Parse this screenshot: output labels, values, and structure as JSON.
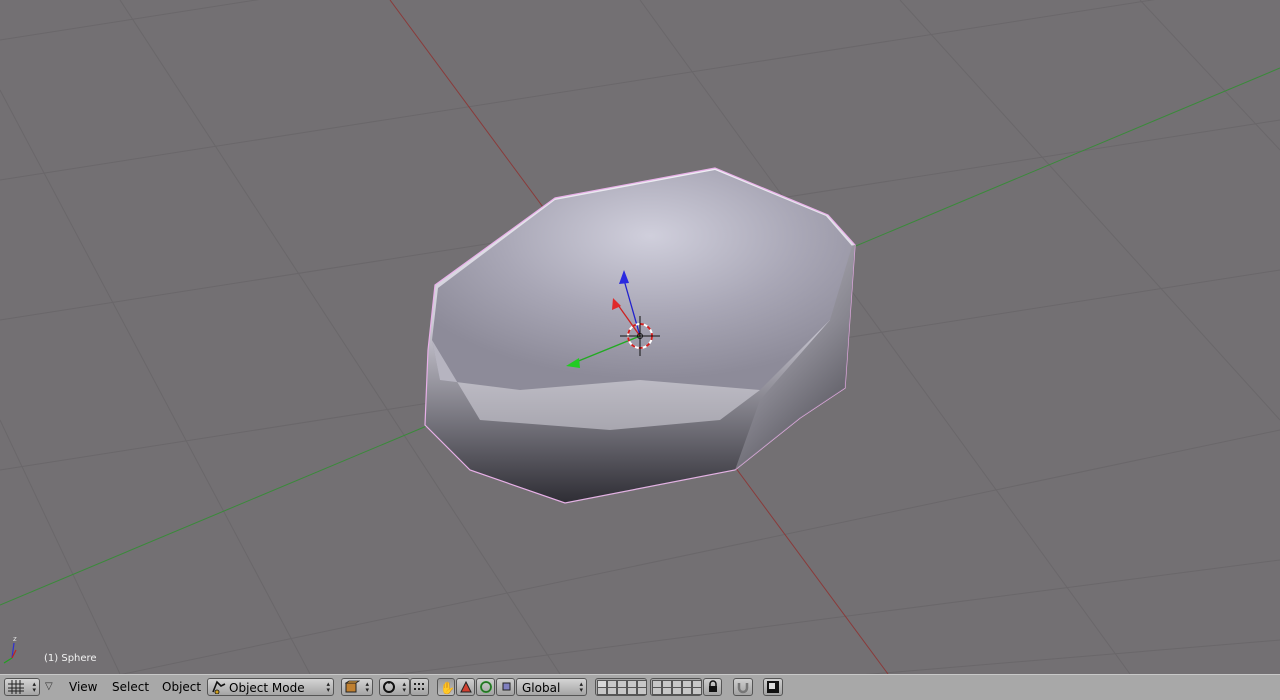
{
  "viewport": {
    "object_label": "(1) Sphere",
    "colors": {
      "background": "#737073",
      "grid": "#6a676a",
      "x_axis": "#8a3a3a",
      "y_axis": "#3a8a3a",
      "selection_outline": "#e8b0e8"
    }
  },
  "header": {
    "editor_type_icon": "grid-icon",
    "menus": [
      "View",
      "Select",
      "Object"
    ],
    "mode": {
      "icon": "object-mode-icon",
      "value": "Object Mode"
    },
    "pivot_icon": "pivot-point-icon",
    "transform_manipulator_icons": [
      "hand-icon",
      "triangle-icon",
      "circle-icon",
      "square-icon"
    ],
    "orientation": {
      "value": "Global"
    },
    "lock_icon": "lock-icon",
    "snap_icon": "magnet-icon",
    "render_icon": "render-icon"
  }
}
